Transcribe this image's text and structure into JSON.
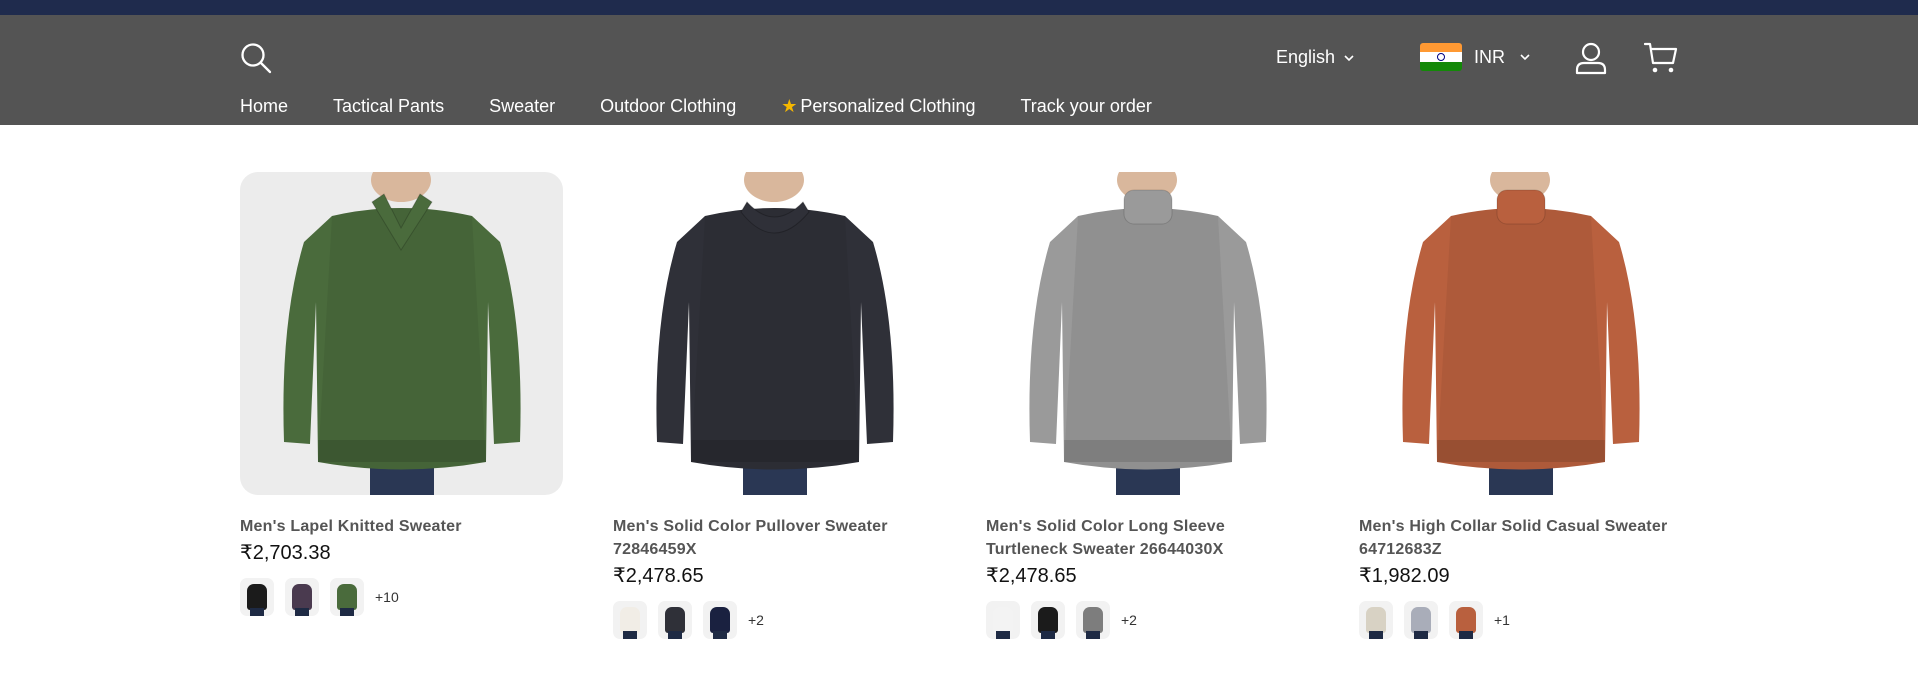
{
  "header": {
    "language": "English",
    "currency": "INR",
    "nav": [
      {
        "label": "Home"
      },
      {
        "label": "Tactical Pants"
      },
      {
        "label": "Sweater"
      },
      {
        "label": "Outdoor Clothing"
      },
      {
        "label": "Personalized Clothing",
        "icon": "star-icon"
      },
      {
        "label": "Track your order"
      }
    ]
  },
  "products": [
    {
      "name": "Men's Lapel Knitted Sweater",
      "price": "₹2,703.38",
      "color": "#4a6b3c",
      "bg": "#ececec",
      "swatches": [
        "#1b1b1b",
        "#4a3a4f",
        "#4a6b3c"
      ],
      "more": "+10"
    },
    {
      "name": "Men's Solid Color Pullover Sweater 72846459X",
      "price": "₹2,478.65",
      "color": "#2f3038",
      "bg": "#ffffff",
      "swatches": [
        "#f1ede6",
        "#2f3038",
        "#1a2140"
      ],
      "more": "+2"
    },
    {
      "name": "Men's Solid Color Long Sleeve Turtleneck Sweater 26644030X",
      "price": "₹2,478.65",
      "color": "#9a9a9a",
      "bg": "#ffffff",
      "swatches": [
        "#f3f3f3",
        "#1b1b1b",
        "#7d7d7d"
      ],
      "more": "+2"
    },
    {
      "name": "Men's High Collar Solid Casual Sweater 64712683Z",
      "price": "₹1,982.09",
      "color": "#b9603e",
      "bg": "#ffffff",
      "swatches": [
        "#d8d2c4",
        "#a9adb9",
        "#b9603e"
      ],
      "more": "+1"
    }
  ]
}
